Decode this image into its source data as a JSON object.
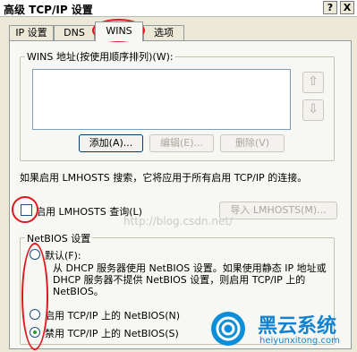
{
  "window": {
    "title": "高级 TCP/IP 设置",
    "help_glyph": "?",
    "close_glyph": "X"
  },
  "tabs": [
    {
      "label": "IP 设置",
      "active": false
    },
    {
      "label": "DNS",
      "active": false
    },
    {
      "label": "WINS",
      "active": true
    },
    {
      "label": "选项",
      "active": false
    }
  ],
  "wins_group": {
    "label": "WINS 地址(按使用顺序排列)(W):",
    "up_arrow_icon": "arrow-up-icon",
    "down_arrow_icon": "arrow-down-icon",
    "add_label": "添加(A)...",
    "edit_label": "编辑(E)...",
    "delete_label": "删除(V)"
  },
  "lmhosts_note": "如果启用 LMHOSTS 搜索，它将应用于所有启用 TCP/IP 的连接。",
  "lmhosts_checkbox": {
    "label": "启用 LMHOSTS 查询(L)",
    "checked": false
  },
  "import_lmhosts_label": "导入 LMHOSTS(M)...",
  "netbios_group": {
    "label": "NetBIOS 设置",
    "options": [
      {
        "label": "默认(F):",
        "selected": false,
        "description": "从 DHCP 服务器使用 NetBIOS 设置。如果使用静态 IP 地址或 DHCP 服务器不提供 NetBIOS 设置，则启用 TCP/IP 上的 NetBIOS。"
      },
      {
        "label": "启用 TCP/IP 上的 NetBIOS(N)",
        "selected": false
      },
      {
        "label": "禁用 TCP/IP 上的 NetBIOS(S)",
        "selected": true
      }
    ]
  },
  "watermark": "http://blog.csdn.net/",
  "logo": {
    "name": "黑云系统",
    "url": "heiyunxitong.com",
    "icon": "swirl-logo-icon"
  },
  "colors": {
    "annotation_red": "#e0191f",
    "logo_blue": "#1283d0"
  }
}
